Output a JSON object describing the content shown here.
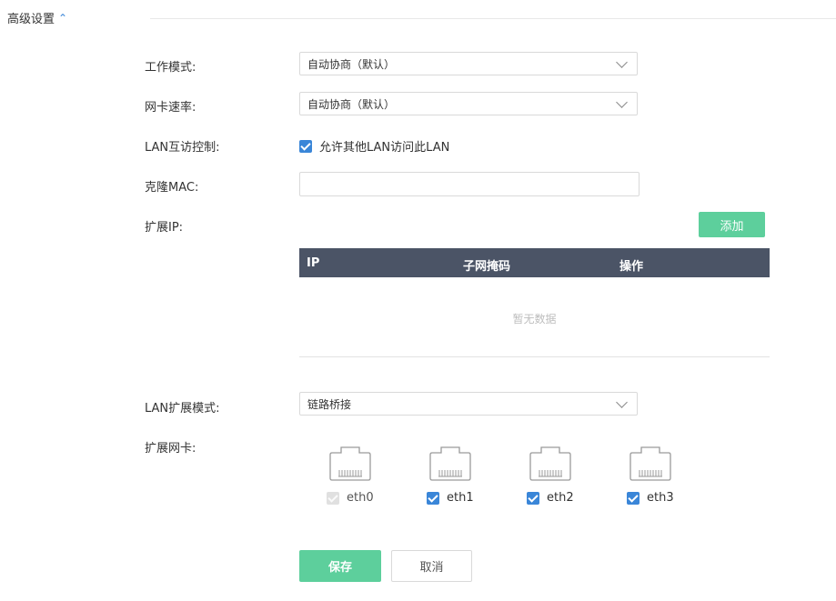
{
  "section": {
    "title": "高级设置",
    "expanded": true
  },
  "form": {
    "work_mode": {
      "label": "工作模式:",
      "value": "自动协商（默认）"
    },
    "nic_speed": {
      "label": "网卡速率:",
      "value": "自动协商（默认）"
    },
    "lan_access": {
      "label": "LAN互访控制:",
      "checkbox_label": "允许其他LAN访问此LAN",
      "checked": true
    },
    "clone_mac": {
      "label": "克隆MAC:",
      "value": ""
    },
    "ext_ip": {
      "label": "扩展IP:",
      "add_button": "添加"
    },
    "lan_ext_mode": {
      "label": "LAN扩展模式:",
      "value": "链路桥接"
    },
    "ext_nic": {
      "label": "扩展网卡:"
    }
  },
  "table": {
    "columns": [
      "IP",
      "子网掩码",
      "操作"
    ],
    "empty_text": "暂无数据"
  },
  "nics": [
    {
      "name": "eth0",
      "checked": true,
      "disabled": true
    },
    {
      "name": "eth1",
      "checked": true,
      "disabled": false
    },
    {
      "name": "eth2",
      "checked": true,
      "disabled": false
    },
    {
      "name": "eth3",
      "checked": true,
      "disabled": false
    }
  ],
  "actions": {
    "save": "保存",
    "cancel": "取消"
  },
  "colors": {
    "accent": "#3a86d8",
    "primary_button": "#5dcf9c",
    "table_header": "#4b5466"
  }
}
